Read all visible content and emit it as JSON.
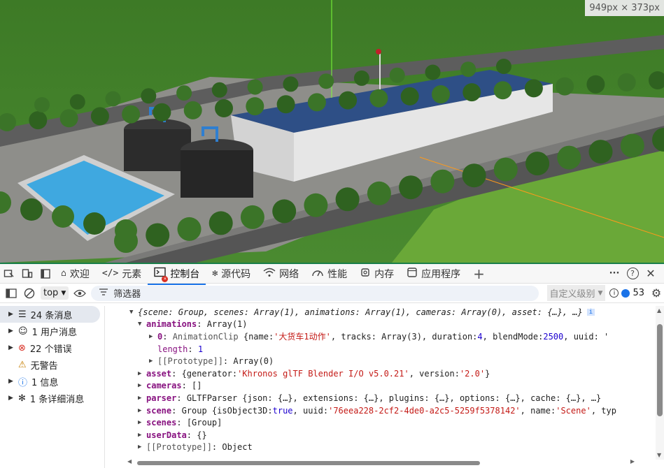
{
  "viewport": {
    "size_badge": "949px × 373px"
  },
  "devtools": {
    "tabs": [
      {
        "icon": "home-icon",
        "label": "欢迎"
      },
      {
        "icon": "code-icon",
        "label": "元素"
      },
      {
        "icon": "console-icon",
        "label": "控制台"
      },
      {
        "icon": "bug-icon",
        "label": "源代码"
      },
      {
        "icon": "wifi-icon",
        "label": "网络"
      },
      {
        "icon": "gauge-icon",
        "label": "性能"
      },
      {
        "icon": "chip-icon",
        "label": "内存"
      },
      {
        "icon": "app-icon",
        "label": "应用程序"
      }
    ],
    "add_tab": "+",
    "more": "···",
    "help": "?",
    "close": "✕"
  },
  "console_toolbar": {
    "context": "top",
    "filter_placeholder": "筛选器",
    "levels": "自定义级别",
    "issues_count": "53"
  },
  "sidebar": {
    "items": [
      {
        "label": "24 条消息",
        "icon": "list-icon"
      },
      {
        "label": "1 用户消息",
        "icon": "user-icon"
      },
      {
        "label": "22 个错误",
        "icon": "error-icon"
      },
      {
        "label": "无警告",
        "icon": "warning-icon"
      },
      {
        "label": "1 信息",
        "icon": "info-icon"
      },
      {
        "label": "1 条详细消息",
        "icon": "bug-icon"
      }
    ]
  },
  "output": {
    "summary": "{scene: Group, scenes: Array(1), animations: Array(1), cameras: Array(0), asset: {…}, …}",
    "info_badge": "i",
    "animations_key": "animations",
    "animations_val": "Array(1)",
    "anim0_key": "0",
    "anim0_type": "AnimationClip",
    "anim0_pre": "{name: ",
    "anim0_name": "'大货车1动作'",
    "anim0_mid1": ", tracks: Array(3), duration: ",
    "anim0_duration": "4",
    "anim0_mid2": ", blendMode: ",
    "anim0_blend": "2500",
    "anim0_tail": ", uuid: '",
    "length_key": "length",
    "length_val": "1",
    "proto1_key": "[[Prototype]]",
    "proto1_val": "Array(0)",
    "asset_key": "asset",
    "asset_pre": "{generator: ",
    "asset_gen": "'Khronos glTF Blender I/O v5.0.21'",
    "asset_mid": ", version: ",
    "asset_ver": "'2.0'",
    "asset_end": "}",
    "cameras_key": "cameras",
    "cameras_val": "[]",
    "parser_key": "parser",
    "parser_val": "GLTFParser {json: {…}, extensions: {…}, plugins: {…}, options: {…}, cache: {…}, …}",
    "scene_key": "scene",
    "scene_pre": "Group {isObject3D: ",
    "scene_bool": "true",
    "scene_mid": ", uuid: ",
    "scene_uuid": "'76eea228-2cf2-4de0-a2c5-5259f5378142'",
    "scene_mid2": ", name: ",
    "scene_name": "'Scene'",
    "scene_tail": ", typ",
    "scenes_key": "scenes",
    "scenes_val": "[Group]",
    "userdata_key": "userData",
    "userdata_val": "{}",
    "proto2_key": "[[Prototype]]",
    "proto2_val": "Object"
  },
  "colors": {
    "accent": "#1a73e8",
    "devtools_border": "#1a7f4a",
    "grass": "#3f7d2a",
    "road": "#5b5b5b",
    "roof": "#2e4f86",
    "pool": "#3fa8e0"
  }
}
